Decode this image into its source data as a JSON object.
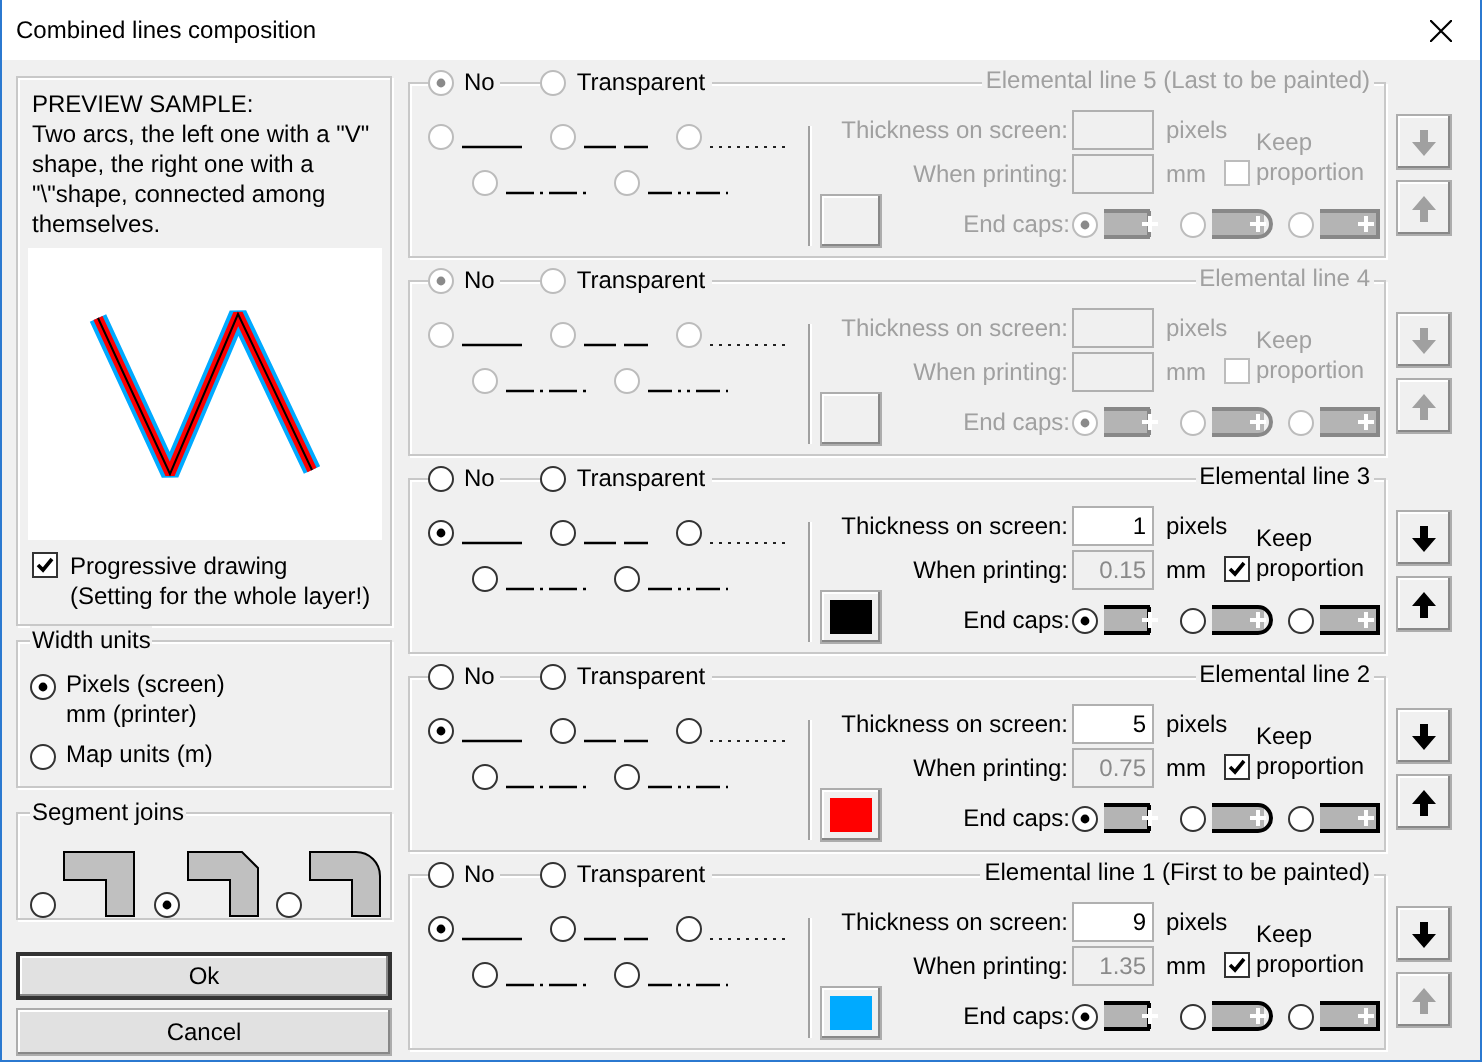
{
  "window": {
    "title": "Combined lines composition"
  },
  "preview": {
    "heading": "PREVIEW SAMPLE:",
    "description": "Two arcs, the left one with a \"V\" shape, the right one with a \"\\\"shape, connected among themselves.",
    "progressive": {
      "label": "Progressive drawing\n(Setting for the whole layer!)",
      "checked": true
    }
  },
  "width_units": {
    "title": "Width units",
    "options": [
      {
        "label": "Pixels (screen)\nmm (printer)",
        "selected": true
      },
      {
        "label": "Map units (m)",
        "selected": false
      }
    ]
  },
  "segment_joins": {
    "title": "Segment joins",
    "options": [
      {
        "kind": "miter",
        "selected": false
      },
      {
        "kind": "bevel",
        "selected": true
      },
      {
        "kind": "round",
        "selected": false
      }
    ]
  },
  "buttons": [
    {
      "label": "Ok",
      "default": true
    },
    {
      "label": "Cancel",
      "default": false
    }
  ],
  "lines": [
    {
      "title": "Elemental line 5 (Last to be painted)",
      "disabled": true,
      "styles": [
        {
          "kind": "none",
          "label": "No",
          "selected": true
        },
        {
          "kind": "transparent",
          "label": "Transparent",
          "selected": false
        },
        {
          "kind": "solid",
          "selected": false
        },
        {
          "kind": "dashed",
          "selected": false
        },
        {
          "kind": "dotted",
          "selected": false
        },
        {
          "kind": "dash-dot",
          "selected": false
        },
        {
          "kind": "dash-dot-dot",
          "selected": false
        }
      ],
      "thickness_label": "Thickness on screen:",
      "thickness_unit": "pixels",
      "printing_label": "When printing:",
      "printing_unit": "mm",
      "keep_proportion": {
        "label": "Keep proportion",
        "checked": false
      },
      "end_caps_label": "End caps:",
      "end_caps": [
        {
          "kind": "butt",
          "selected": true
        },
        {
          "kind": "round",
          "selected": false
        },
        {
          "kind": "square",
          "selected": false
        }
      ],
      "move_down_disabled": true,
      "move_up_disabled": true
    },
    {
      "title": "Elemental line 4",
      "disabled": true,
      "styles": [
        {
          "kind": "none",
          "label": "No",
          "selected": true
        },
        {
          "kind": "transparent",
          "label": "Transparent",
          "selected": false
        },
        {
          "kind": "solid",
          "selected": false
        },
        {
          "kind": "dashed",
          "selected": false
        },
        {
          "kind": "dotted",
          "selected": false
        },
        {
          "kind": "dash-dot",
          "selected": false
        },
        {
          "kind": "dash-dot-dot",
          "selected": false
        }
      ],
      "thickness_label": "Thickness on screen:",
      "thickness_unit": "pixels",
      "printing_label": "When printing:",
      "printing_unit": "mm",
      "keep_proportion": {
        "label": "Keep proportion",
        "checked": false
      },
      "end_caps_label": "End caps:",
      "end_caps": [
        {
          "kind": "butt",
          "selected": true
        },
        {
          "kind": "round",
          "selected": false
        },
        {
          "kind": "square",
          "selected": false
        }
      ],
      "move_down_disabled": true,
      "move_up_disabled": true
    },
    {
      "title": "Elemental line 3",
      "disabled": false,
      "styles": [
        {
          "kind": "none",
          "label": "No",
          "selected": false
        },
        {
          "kind": "transparent",
          "label": "Transparent",
          "selected": false
        },
        {
          "kind": "solid",
          "selected": true
        },
        {
          "kind": "dashed",
          "selected": false
        },
        {
          "kind": "dotted",
          "selected": false
        },
        {
          "kind": "dash-dot",
          "selected": false
        },
        {
          "kind": "dash-dot-dot",
          "selected": false
        }
      ],
      "thickness_label": "Thickness on screen:",
      "thickness": "1",
      "thickness_unit": "pixels",
      "printing_label": "When printing:",
      "printing": "0.15",
      "printing_unit": "mm",
      "keep_proportion": {
        "label": "Keep proportion",
        "checked": true
      },
      "color": "#000000",
      "end_caps_label": "End caps:",
      "end_caps": [
        {
          "kind": "butt",
          "selected": true
        },
        {
          "kind": "round",
          "selected": false
        },
        {
          "kind": "square",
          "selected": false
        }
      ],
      "move_down_disabled": false,
      "move_up_disabled": false
    },
    {
      "title": "Elemental line 2",
      "disabled": false,
      "styles": [
        {
          "kind": "none",
          "label": "No",
          "selected": false
        },
        {
          "kind": "transparent",
          "label": "Transparent",
          "selected": false
        },
        {
          "kind": "solid",
          "selected": true
        },
        {
          "kind": "dashed",
          "selected": false
        },
        {
          "kind": "dotted",
          "selected": false
        },
        {
          "kind": "dash-dot",
          "selected": false
        },
        {
          "kind": "dash-dot-dot",
          "selected": false
        }
      ],
      "thickness_label": "Thickness on screen:",
      "thickness": "5",
      "thickness_unit": "pixels",
      "printing_label": "When printing:",
      "printing": "0.75",
      "printing_unit": "mm",
      "keep_proportion": {
        "label": "Keep proportion",
        "checked": true
      },
      "color": "#ff0000",
      "end_caps_label": "End caps:",
      "end_caps": [
        {
          "kind": "butt",
          "selected": true
        },
        {
          "kind": "round",
          "selected": false
        },
        {
          "kind": "square",
          "selected": false
        }
      ],
      "move_down_disabled": false,
      "move_up_disabled": false
    },
    {
      "title": "Elemental line 1 (First to be painted)",
      "disabled": false,
      "styles": [
        {
          "kind": "none",
          "label": "No",
          "selected": false
        },
        {
          "kind": "transparent",
          "label": "Transparent",
          "selected": false
        },
        {
          "kind": "solid",
          "selected": true
        },
        {
          "kind": "dashed",
          "selected": false
        },
        {
          "kind": "dotted",
          "selected": false
        },
        {
          "kind": "dash-dot",
          "selected": false
        },
        {
          "kind": "dash-dot-dot",
          "selected": false
        }
      ],
      "thickness_label": "Thickness on screen:",
      "thickness": "9",
      "thickness_unit": "pixels",
      "printing_label": "When printing:",
      "printing": "1.35",
      "printing_unit": "mm",
      "keep_proportion": {
        "label": "Keep proportion",
        "checked": true
      },
      "color": "#00aaff",
      "end_caps_label": "End caps:",
      "end_caps": [
        {
          "kind": "butt",
          "selected": true
        },
        {
          "kind": "round",
          "selected": false
        },
        {
          "kind": "square",
          "selected": false
        }
      ],
      "move_down_disabled": false,
      "move_up_disabled": true
    }
  ]
}
